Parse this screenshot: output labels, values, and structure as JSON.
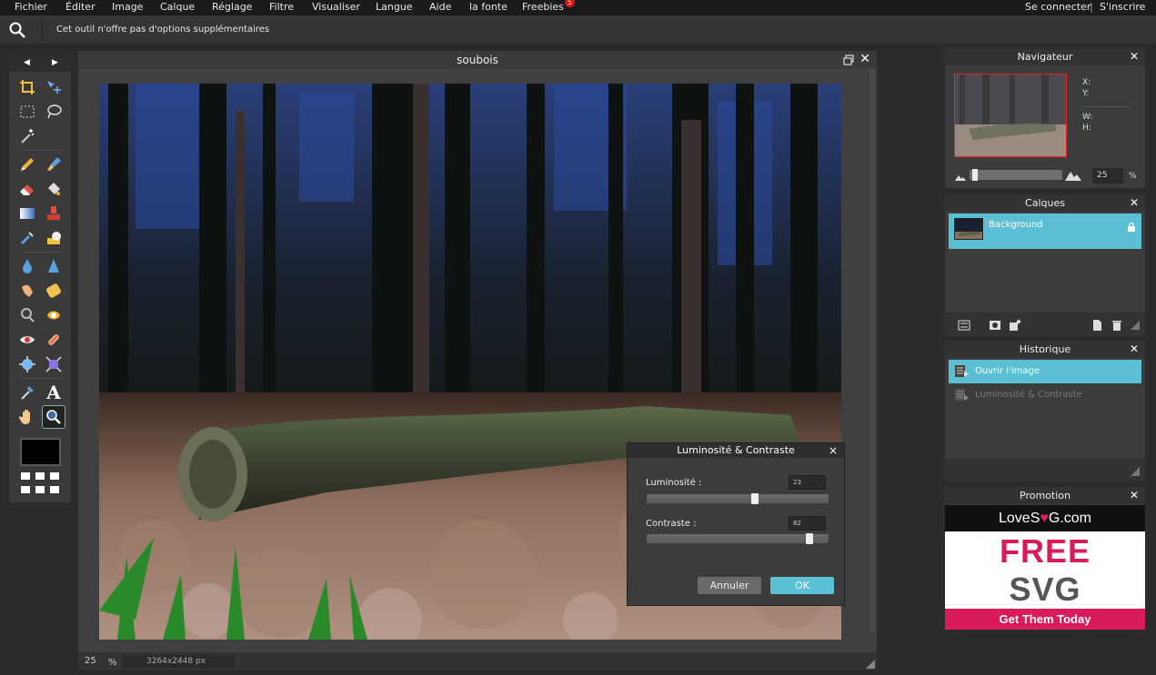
{
  "menu": {
    "items": [
      "Fichier",
      "Éditer",
      "Image",
      "Calque",
      "Réglage",
      "Filtre",
      "Visualiser",
      "Langue",
      "Aide",
      "la fonte",
      "Freebies"
    ],
    "freebies_badge": "5",
    "right": {
      "login": "Se connecter",
      "separator": "|",
      "signup": "S'inscrire"
    }
  },
  "options_bar": {
    "message": "Cet outil n'offre pas d'options supplémentaires",
    "icon": "zoom-icon"
  },
  "toolbox": {
    "nav_prev": "◀",
    "nav_next": "▶",
    "tools": [
      "crop-icon",
      "move-icon",
      "marquee-icon",
      "lasso-icon",
      "magic-wand-icon",
      "pencil-icon",
      "brush-icon",
      "eraser-icon",
      "bucket-icon",
      "gradient-icon",
      "stamp-icon",
      "color-replace-icon",
      "smudge-dodge-icon",
      "blur-icon",
      "sharpen-icon",
      "smudge-icon",
      "sponge-icon",
      "burn-icon",
      "dodge-icon",
      "red-eye-icon",
      "spot-heal-icon",
      "bloat-icon",
      "pinch-icon",
      "eyedropper-icon",
      "text-icon",
      "hand-icon",
      "zoom-icon"
    ],
    "text_tool_glyph": "A",
    "active_tool": "zoom-icon",
    "foreground_color": "#000000"
  },
  "document": {
    "title": "soubois",
    "zoom": "25",
    "zoom_unit": "%",
    "dimensions": "3264x2448 px"
  },
  "dialog": {
    "title": "Luminosité & Contraste",
    "close": "×",
    "brightness_label": "Luminosité :",
    "brightness_value": "23",
    "brightness_level": 0.6,
    "contrast_label": "Contraste :",
    "contrast_value": "82",
    "contrast_level": 0.91,
    "cancel": "Annuler",
    "ok": "OK"
  },
  "navigator": {
    "title": "Navigateur",
    "x_label": "X:",
    "y_label": "Y:",
    "w_label": "W:",
    "h_label": "H:",
    "zoom_value": "25",
    "zoom_unit": "%",
    "zoom_level": 0.03
  },
  "layers": {
    "title": "Calques",
    "items": [
      {
        "name": "Background",
        "locked": true
      }
    ]
  },
  "history": {
    "title": "Historique",
    "items": [
      {
        "label": "Ouvrir l'image",
        "selected": true
      },
      {
        "label": "Luminosité & Contraste",
        "selected": false
      }
    ]
  },
  "promotion": {
    "title": "Promotion",
    "logo_prefix": "LoveS",
    "logo_heart": "♥",
    "logo_suffix": "G.com",
    "headline": "FREE",
    "subheadline": "SVG",
    "cta": "Get Them Today"
  },
  "colors": {
    "accent": "#5bc0d4",
    "promo_pink": "#d91b5c",
    "menu_bg": "#1b1b1b",
    "panel_bg": "#3c3c3c"
  }
}
